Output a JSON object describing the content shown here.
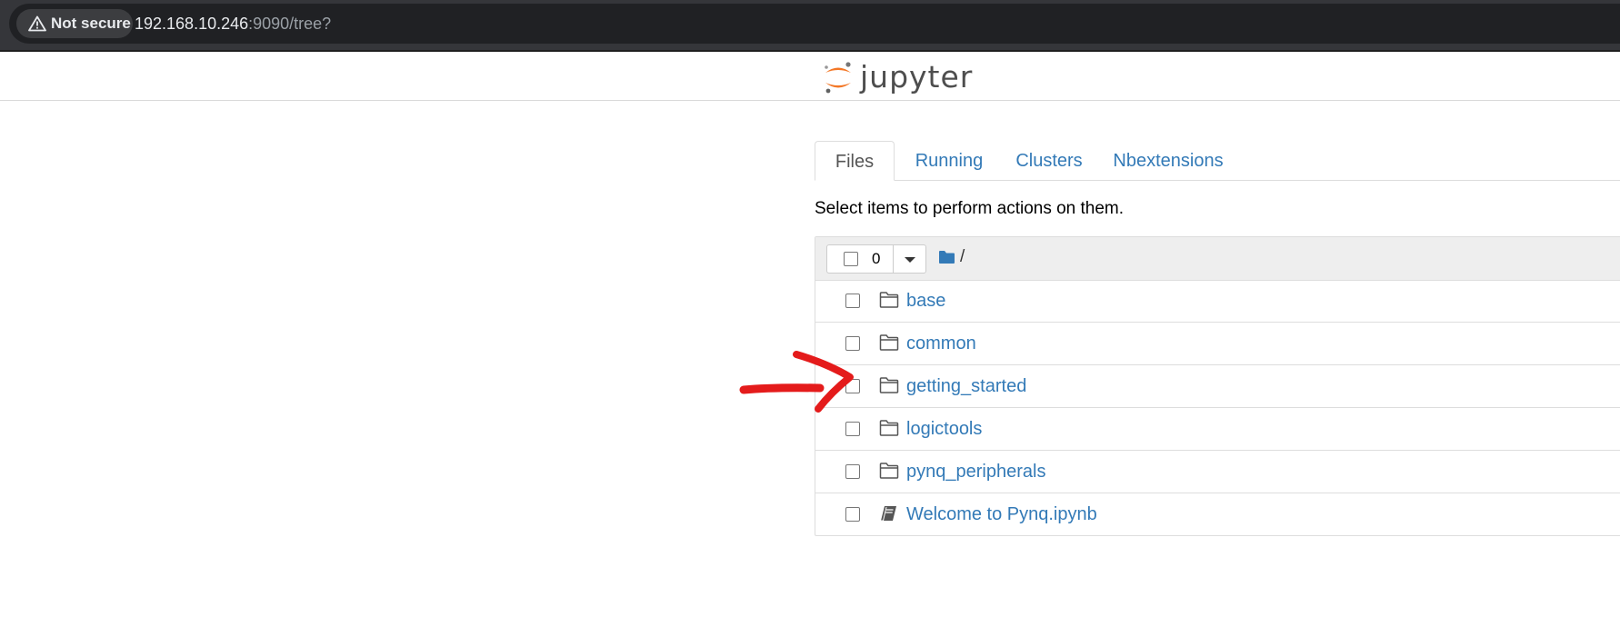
{
  "browser": {
    "security_label": "Not secure",
    "url_host": "192.168.10.246",
    "url_path": ":9090/tree?"
  },
  "header": {
    "logo_text": "jupyter",
    "logo_icon": "jupyter-logo-icon"
  },
  "tabs": [
    {
      "label": "Files",
      "active": true
    },
    {
      "label": "Running",
      "active": false
    },
    {
      "label": "Clusters",
      "active": false
    },
    {
      "label": "Nbextensions",
      "active": false
    }
  ],
  "instructions": "Select items to perform actions on them.",
  "list_header": {
    "selected_count": "0",
    "breadcrumb": "/",
    "folder_icon": "folder-solid-icon"
  },
  "files": [
    {
      "name": "base",
      "type": "folder",
      "icon": "folder-icon"
    },
    {
      "name": "common",
      "type": "folder",
      "icon": "folder-icon"
    },
    {
      "name": "getting_started",
      "type": "folder",
      "icon": "folder-icon"
    },
    {
      "name": "logictools",
      "type": "folder",
      "icon": "folder-icon"
    },
    {
      "name": "pynq_peripherals",
      "type": "folder",
      "icon": "folder-icon"
    },
    {
      "name": "Welcome to Pynq.ipynb",
      "type": "notebook",
      "icon": "notebook-icon"
    }
  ],
  "colors": {
    "link": "#337ab7",
    "jupyter_orange": "#f37726",
    "annotation_red": "#e41b1b",
    "browser_bg": "#35363a"
  }
}
